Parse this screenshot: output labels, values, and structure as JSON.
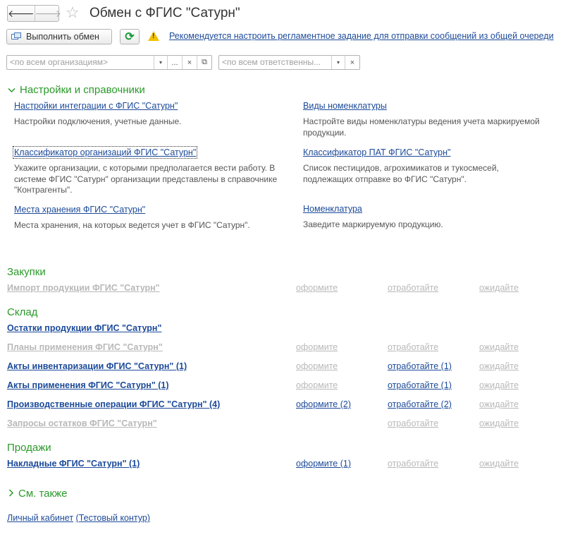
{
  "window": {
    "title": "Обмен с ФГИС \"Сатурн\"",
    "back_glyph": "🡐",
    "forward_glyph": "🡒",
    "star_glyph": "☆"
  },
  "toolbar": {
    "execute_label": "Выполнить обмен",
    "refresh_glyph": "⟳",
    "warning_text": "Рекомендуется настроить регламентное задание для отправки сообщений из общей очереди"
  },
  "filters": {
    "organizations_placeholder": "<по всем организациям>",
    "responsible_placeholder": "<по всем ответственны...",
    "dropdown_glyph": "▾",
    "select_glyph": "...",
    "clear_glyph": "×",
    "open_glyph": "⧉"
  },
  "settings": {
    "header": "Настройки и справочники",
    "items": [
      {
        "link": "Настройки интеграции с ФГИС \"Сатурн\"",
        "desc": "Настройки подключения, учетные данные."
      },
      {
        "link": "Виды номенклатуры",
        "desc": "Настройте виды номенклатуры ведения учета маркируемой продукции."
      },
      {
        "link": "Классификатор организаций ФГИС \"Сатурн\"",
        "desc": "Укажите организации, с которыми предполагается вести работу. В системе ФГИС \"Сатурн\" организации представлены в справочнике \"Контрагенты\"."
      },
      {
        "link": "Классификатор ПАТ ФГИС \"Сатурн\"",
        "desc": "Список пестицидов, агрохимикатов и тукосмесей, подлежащих отправке во ФГИС \"Сатурн\"."
      },
      {
        "link": "Места хранения ФГИС \"Сатурн\"",
        "desc": "Места хранения, на которых ведется учет в ФГИС \"Сатурн\"."
      },
      {
        "link": "Номенклатура",
        "desc": "Заведите маркируемую продукцию."
      }
    ]
  },
  "purchases": {
    "header": "Закупки",
    "rows": [
      {
        "label": "Импорт продукции ФГИС \"Сатурн\"",
        "col1": "оформите",
        "col2": "отработайте",
        "col3": "ожидайте"
      }
    ]
  },
  "warehouse": {
    "header": "Склад",
    "rows": [
      {
        "label": "Остатки продукции ФГИС \"Сатурн\"",
        "col1": "",
        "col2": "",
        "col3": ""
      },
      {
        "label": "Планы применения ФГИС \"Сатурн\"",
        "col1": "оформите",
        "col2": "отработайте",
        "col3": "ожидайте"
      },
      {
        "label": "Акты инвентаризации ФГИС \"Сатурн\" (1)",
        "col1": "оформите",
        "col2": "отработайте (1)",
        "col3": "ожидайте"
      },
      {
        "label": "Акты применения ФГИС \"Сатурн\" (1)",
        "col1": "оформите",
        "col2": "отработайте (1)",
        "col3": "ожидайте"
      },
      {
        "label": "Производственные операции ФГИС \"Сатурн\" (4)",
        "col1": "оформите (2)",
        "col2": "отработайте (2)",
        "col3": "ожидайте"
      },
      {
        "label": "Запросы остатков ФГИС \"Сатурн\"",
        "col1": "",
        "col2": "отработайте",
        "col3": "ожидайте"
      }
    ]
  },
  "sales": {
    "header": "Продажи",
    "rows": [
      {
        "label": "Накладные ФГИС \"Сатурн\" (1)",
        "col1": "оформите (1)",
        "col2": "отработайте",
        "col3": "ожидайте"
      }
    ]
  },
  "see_also": {
    "header": "См. также"
  },
  "footer": {
    "cabinet_label": "Личный кабинет",
    "test_label": "(Тестовый контур)"
  },
  "colors": {
    "link": "#1c4a9a",
    "section": "#2a9a2a",
    "disabled": "#b8b8b8",
    "warning": "#f2c200"
  }
}
